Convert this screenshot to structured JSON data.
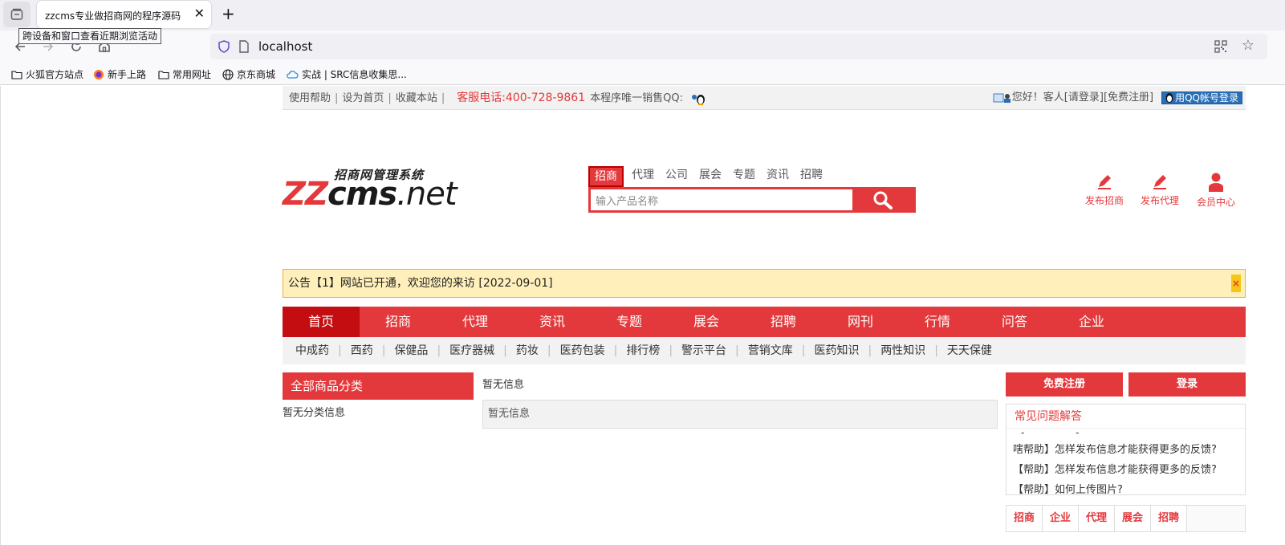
{
  "browser": {
    "tab_title": "zzcms专业做招商网的程序源码",
    "tooltip": "跨设备和窗口查看近期浏览活动",
    "url": "localhost",
    "bookmarks": [
      "火狐官方站点",
      "新手上路",
      "常用网址",
      "京东商城",
      "实战 | SRC信息收集思..."
    ]
  },
  "topbar": {
    "links": [
      "使用帮助",
      "设为首页",
      "收藏本站"
    ],
    "separator": "|",
    "hotline": "客服电话:400-728-9861",
    "qq_text": "本程序唯一销售QQ:",
    "greeting": "您好！客人",
    "login": "[请登录]",
    "register": "[免费注册]",
    "qq_login": "用QQ帐号登录"
  },
  "logo": {
    "sub": "招商网管理系统",
    "zz": "ZZ",
    "cms": "cms",
    "net": ".net"
  },
  "search": {
    "tabs": [
      "招商",
      "代理",
      "公司",
      "展会",
      "专题",
      "资讯",
      "招聘"
    ],
    "placeholder": "输入产品名称"
  },
  "quick_links": [
    "发布招商",
    "发布代理",
    "会员中心"
  ],
  "notice": {
    "text": "公告【1】网站已开通，欢迎您的来访 [2022-09-01]",
    "close": "×"
  },
  "main_nav": [
    "首页",
    "招商",
    "代理",
    "资讯",
    "专题",
    "展会",
    "招聘",
    "网刊",
    "行情",
    "问答",
    "企业"
  ],
  "sub_nav": [
    "中成药",
    "西药",
    "保健品",
    "医疗器械",
    "药妆",
    "医药包装",
    "排行榜",
    "警示平台",
    "营销文库",
    "医药知识",
    "两性知识",
    "天天保健"
  ],
  "categories": {
    "title": "全部商品分类",
    "empty": "暂无分类信息"
  },
  "middle": {
    "title": "暂无信息",
    "box": "暂无信息"
  },
  "side": {
    "register_btn": "免费注册",
    "login_btn": "登录",
    "faq_title": "常见问题解答",
    "faq_dashes": "- -",
    "faq_items": [
      "嗐帮助】怎样发布信息才能获得更多的反馈?",
      "【帮助】怎样发布信息才能获得更多的反馈?",
      "【帮助】如何上传图片?"
    ],
    "tabs": [
      "招商",
      "企业",
      "代理",
      "展会",
      "招聘"
    ]
  }
}
